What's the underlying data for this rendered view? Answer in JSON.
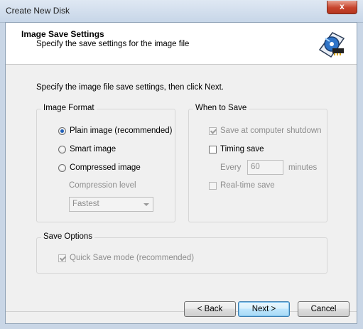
{
  "window": {
    "title": "Create New Disk",
    "close_glyph": "x"
  },
  "header": {
    "title": "Image Save Settings",
    "subtitle": "Specify the save settings for the image file",
    "logo_icon": "disk-image-logo-icon"
  },
  "instruction": "Specify the image file save settings, then click Next.",
  "image_format": {
    "label": "Image Format",
    "options": [
      {
        "label": "Plain image (recommended)",
        "checked": true
      },
      {
        "label": "Smart image",
        "checked": false
      },
      {
        "label": "Compressed image",
        "checked": false
      }
    ],
    "compression_label": "Compression level",
    "compression_value": "Fastest"
  },
  "when_to_save": {
    "label": "When to Save",
    "shutdown": {
      "label": "Save at computer shutdown",
      "checked": true,
      "enabled": false
    },
    "timing": {
      "label": "Timing save",
      "checked": false,
      "enabled": true
    },
    "every_label": "Every",
    "every_value": "60",
    "minutes_label": "minutes",
    "realtime": {
      "label": "Real-time save",
      "checked": false,
      "enabled": false
    }
  },
  "save_options": {
    "label": "Save Options",
    "quick_save": {
      "label": "Quick Save mode (recommended)",
      "checked": true,
      "enabled": false
    }
  },
  "buttons": {
    "back": "< Back",
    "next": "Next >",
    "cancel": "Cancel"
  },
  "colors": {
    "accent": "#1f5fb8",
    "disabled_text": "#8d8d8d",
    "close": "#c7432c"
  }
}
